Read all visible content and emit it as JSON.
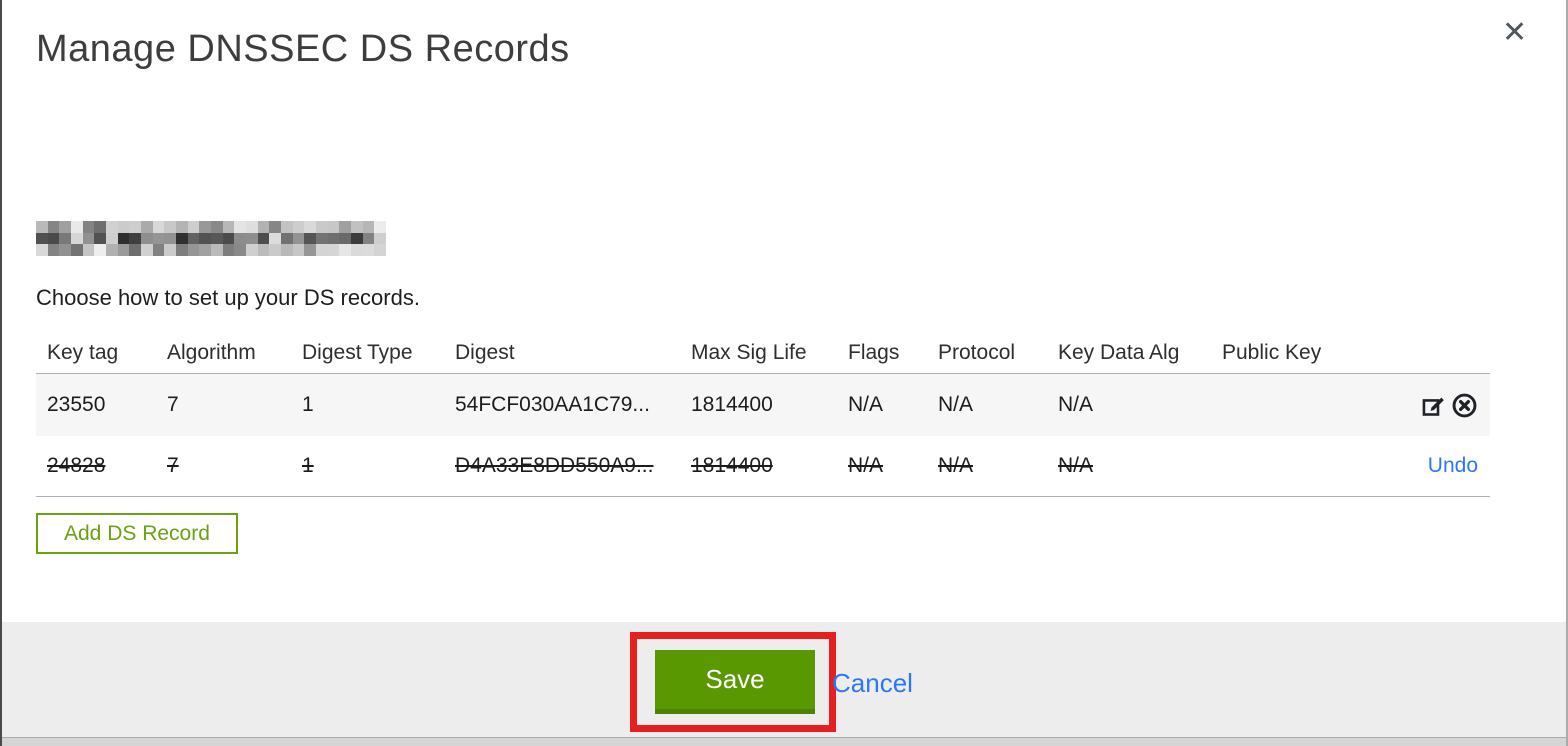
{
  "modal": {
    "title": "Manage DNSSEC DS Records",
    "close_icon": "✕"
  },
  "intro": {
    "domain_redacted": true,
    "instruction": "Choose how to set up your DS records."
  },
  "table": {
    "columns": [
      "Key tag",
      "Algorithm",
      "Digest Type",
      "Digest",
      "Max Sig Life",
      "Flags",
      "Protocol",
      "Key Data Alg",
      "Public Key"
    ],
    "rows": [
      {
        "key_tag": "23550",
        "algorithm": "7",
        "digest_type": "1",
        "digest": "54FCF030AA1C79...",
        "max_sig_life": "1814400",
        "flags": "N/A",
        "protocol": "N/A",
        "key_data_alg": "N/A",
        "public_key": "",
        "state": "normal",
        "actions": [
          "edit",
          "delete"
        ]
      },
      {
        "key_tag": "24828",
        "algorithm": "7",
        "digest_type": "1",
        "digest": "D4A33E8DD550A9...",
        "max_sig_life": "1814400",
        "flags": "N/A",
        "protocol": "N/A",
        "key_data_alg": "N/A",
        "public_key": "",
        "state": "deleted",
        "undo_label": "Undo"
      }
    ]
  },
  "buttons": {
    "add_ds_record": "Add DS Record",
    "save": "Save",
    "cancel": "Cancel"
  },
  "annotation": {
    "shape": "red-rectangle-highlight",
    "target": "save-button",
    "color": "#E6201E"
  },
  "colors": {
    "outline_green": "#6BA20F",
    "save_green": "#5A9802",
    "link_blue": "#2B78F2",
    "row_gray": "#F6F6F6",
    "footer_gray": "#EDEDED"
  }
}
